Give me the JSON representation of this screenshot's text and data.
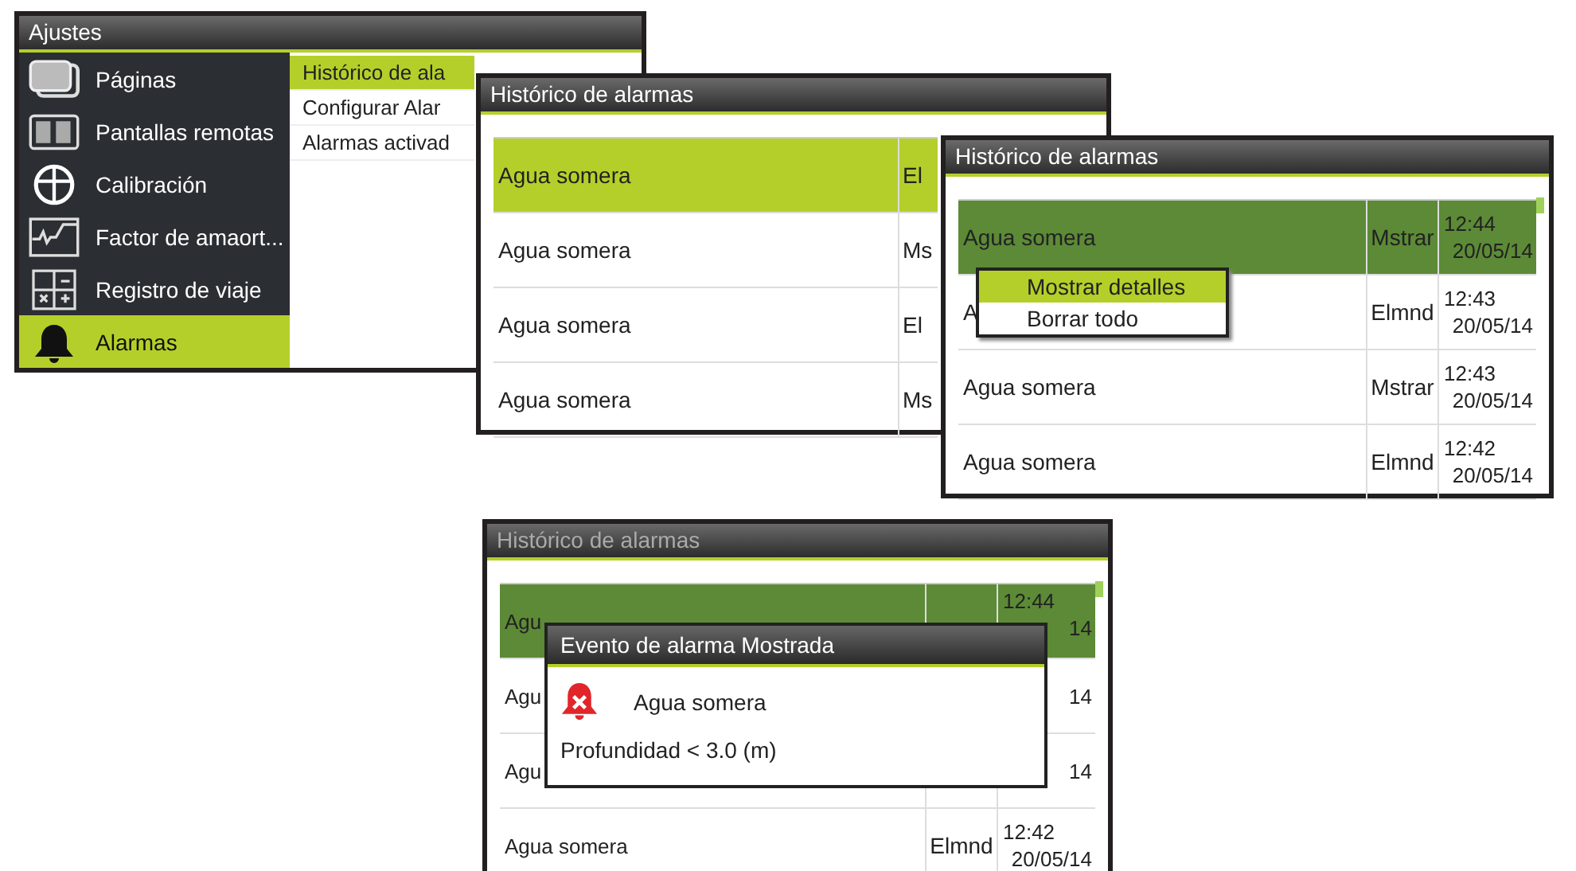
{
  "settings_window": {
    "title": "Ajustes",
    "sidebar": [
      {
        "label": "Páginas",
        "selected": false
      },
      {
        "label": "Pantallas remotas",
        "selected": false
      },
      {
        "label": "Calibración",
        "selected": false
      },
      {
        "label": "Factor de amaort...",
        "selected": false
      },
      {
        "label": "Registro de viaje",
        "selected": false
      },
      {
        "label": "Alarmas",
        "selected": true
      }
    ],
    "submenu": [
      {
        "label": "Histórico de ala",
        "selected": true
      },
      {
        "label": "Configurar Alar",
        "selected": false
      },
      {
        "label": "Alarmas activad",
        "selected": false
      }
    ]
  },
  "history_windows": [
    {
      "title": "Histórico de alarmas",
      "active": true,
      "dimmed": false,
      "rows": [
        {
          "name": "Agua somera",
          "status": "El",
          "selected": true
        },
        {
          "name": "Agua somera",
          "status": "Ms",
          "selected": false
        },
        {
          "name": "Agua somera",
          "status": "El",
          "selected": false
        },
        {
          "name": "Agua somera",
          "status": "Ms",
          "selected": false
        }
      ]
    },
    {
      "title": "Histórico de alarmas",
      "active": false,
      "dimmed": false,
      "rows": [
        {
          "name": "Agua somera",
          "status": "Mstrar",
          "time": "12:44",
          "date": "20/05/14",
          "selected": true
        },
        {
          "name": "A",
          "status": "Elmnd",
          "time": "12:43",
          "date": "20/05/14",
          "selected": false
        },
        {
          "name": "Agua somera",
          "status": "Mstrar",
          "time": "12:43",
          "date": "20/05/14",
          "selected": false
        },
        {
          "name": "Agua somera",
          "status": "Elmnd",
          "time": "12:42",
          "date": "20/05/14",
          "selected": false
        }
      ],
      "context_menu": {
        "items": [
          {
            "label": "Mostrar detalles",
            "selected": true
          },
          {
            "label": "Borrar todo",
            "selected": false
          }
        ]
      }
    },
    {
      "title": "Histórico de alarmas",
      "active": false,
      "dimmed": true,
      "rows": [
        {
          "name": "Agu",
          "time": "12:44",
          "date": "14",
          "selected": true
        },
        {
          "name": "Agu",
          "date": "14",
          "selected": false
        },
        {
          "name": "Agu",
          "date": "14",
          "selected": false
        },
        {
          "name": "Agua somera",
          "status": "Elmnd",
          "time": "12:42",
          "date": "20/05/14",
          "selected": false
        }
      ],
      "dialog": {
        "title": "Evento de alarma Mostrada",
        "alarm": "Agua somera",
        "detail": "Profundidad < 3.0 (m)"
      }
    }
  ]
}
